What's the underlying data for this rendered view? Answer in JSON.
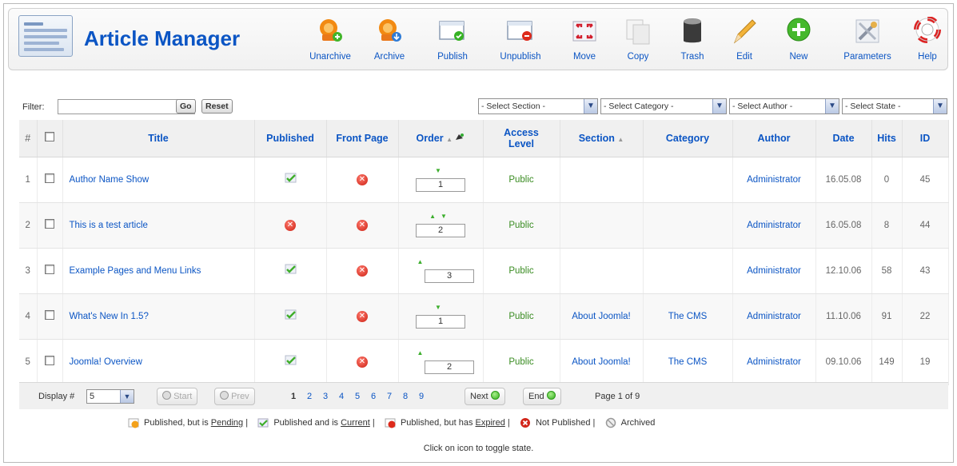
{
  "header": {
    "title": "Article Manager"
  },
  "toolbar": {
    "unarchive": "Unarchive",
    "archive": "Archive",
    "publish": "Publish",
    "unpublish": "Unpublish",
    "move": "Move",
    "copy": "Copy",
    "trash": "Trash",
    "edit": "Edit",
    "new": "New",
    "parameters": "Parameters",
    "help": "Help"
  },
  "filter": {
    "label": "Filter:",
    "value": "",
    "go": "Go",
    "reset": "Reset",
    "section": "- Select Section -",
    "category": "- Select Category -",
    "author": "- Select Author -",
    "state": "- Select State -"
  },
  "columns": {
    "num": "#",
    "title": "Title",
    "published": "Published",
    "front_page": "Front Page",
    "order": "Order",
    "access_level": "Access Level",
    "section": "Section",
    "category": "Category",
    "author": "Author",
    "date": "Date",
    "hits": "Hits",
    "id": "ID"
  },
  "rows": [
    {
      "num": "1",
      "title": "Author Name Show",
      "published": "check",
      "front_page": "x",
      "order": "1",
      "arrows": "down",
      "access": "Public",
      "section": "",
      "category": "",
      "author": "Administrator",
      "date": "16.05.08",
      "hits": "0",
      "id": "45"
    },
    {
      "num": "2",
      "title": "This is a test article",
      "published": "x",
      "front_page": "x",
      "order": "2",
      "arrows": "both",
      "access": "Public",
      "section": "",
      "category": "",
      "author": "Administrator",
      "date": "16.05.08",
      "hits": "8",
      "id": "44"
    },
    {
      "num": "3",
      "title": "Example Pages and Menu Links",
      "published": "check",
      "front_page": "x",
      "order": "3",
      "arrows": "up",
      "access": "Public",
      "section": "",
      "category": "",
      "author": "Administrator",
      "date": "12.10.06",
      "hits": "58",
      "id": "43"
    },
    {
      "num": "4",
      "title": "What's New In 1.5?",
      "published": "check",
      "front_page": "x",
      "order": "1",
      "arrows": "down",
      "access": "Public",
      "section": "About Joomla!",
      "category": "The CMS",
      "author": "Administrator",
      "date": "11.10.06",
      "hits": "91",
      "id": "22"
    },
    {
      "num": "5",
      "title": "Joomla! Overview",
      "published": "check",
      "front_page": "x",
      "order": "2",
      "arrows": "up",
      "access": "Public",
      "section": "About Joomla!",
      "category": "The CMS",
      "author": "Administrator",
      "date": "09.10.06",
      "hits": "149",
      "id": "19"
    }
  ],
  "pagination": {
    "display_label": "Display #",
    "display_value": "5",
    "start": "Start",
    "prev": "Prev",
    "pages": [
      "1",
      "2",
      "3",
      "4",
      "5",
      "6",
      "7",
      "8",
      "9"
    ],
    "next": "Next",
    "end": "End",
    "page_of": "Page 1 of 9"
  },
  "legend": {
    "pending_prefix": "Published, but is ",
    "pending": "Pending",
    "current_prefix": "Published and is ",
    "current": "Current",
    "expired_prefix": "Published, but has ",
    "expired": "Expired",
    "not_published": "Not Published",
    "archived": "Archived",
    "separator": " |",
    "note": "Click on icon to toggle state."
  },
  "colors": {
    "link": "#0b55c4",
    "access_green": "#3a8c22",
    "unpublished_red": "#cc1f12"
  }
}
